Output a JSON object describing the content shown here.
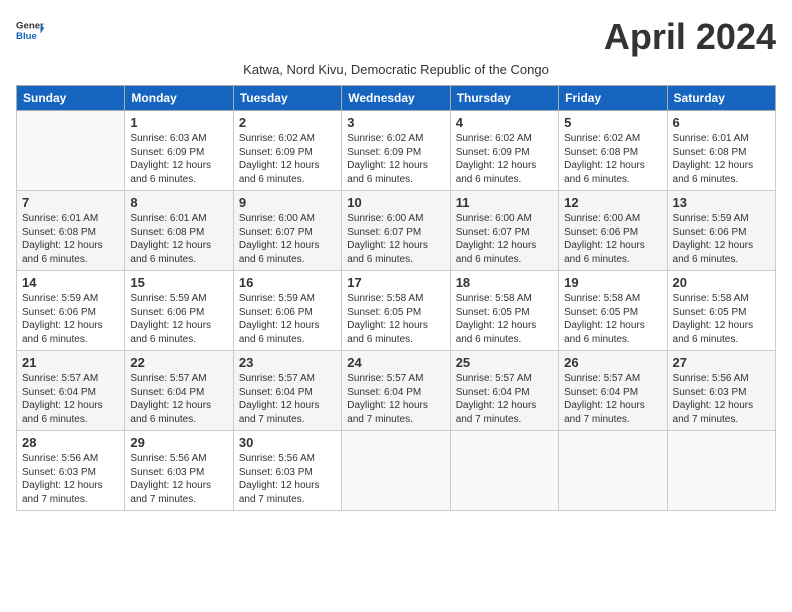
{
  "header": {
    "logo_general": "General",
    "logo_blue": "Blue",
    "month_title": "April 2024",
    "subtitle": "Katwa, Nord Kivu, Democratic Republic of the Congo"
  },
  "weekdays": [
    "Sunday",
    "Monday",
    "Tuesday",
    "Wednesday",
    "Thursday",
    "Friday",
    "Saturday"
  ],
  "weeks": [
    [
      {
        "day": "",
        "info": ""
      },
      {
        "day": "1",
        "info": "Sunrise: 6:03 AM\nSunset: 6:09 PM\nDaylight: 12 hours\nand 6 minutes."
      },
      {
        "day": "2",
        "info": "Sunrise: 6:02 AM\nSunset: 6:09 PM\nDaylight: 12 hours\nand 6 minutes."
      },
      {
        "day": "3",
        "info": "Sunrise: 6:02 AM\nSunset: 6:09 PM\nDaylight: 12 hours\nand 6 minutes."
      },
      {
        "day": "4",
        "info": "Sunrise: 6:02 AM\nSunset: 6:09 PM\nDaylight: 12 hours\nand 6 minutes."
      },
      {
        "day": "5",
        "info": "Sunrise: 6:02 AM\nSunset: 6:08 PM\nDaylight: 12 hours\nand 6 minutes."
      },
      {
        "day": "6",
        "info": "Sunrise: 6:01 AM\nSunset: 6:08 PM\nDaylight: 12 hours\nand 6 minutes."
      }
    ],
    [
      {
        "day": "7",
        "info": "Sunrise: 6:01 AM\nSunset: 6:08 PM\nDaylight: 12 hours\nand 6 minutes."
      },
      {
        "day": "8",
        "info": "Sunrise: 6:01 AM\nSunset: 6:08 PM\nDaylight: 12 hours\nand 6 minutes."
      },
      {
        "day": "9",
        "info": "Sunrise: 6:00 AM\nSunset: 6:07 PM\nDaylight: 12 hours\nand 6 minutes."
      },
      {
        "day": "10",
        "info": "Sunrise: 6:00 AM\nSunset: 6:07 PM\nDaylight: 12 hours\nand 6 minutes."
      },
      {
        "day": "11",
        "info": "Sunrise: 6:00 AM\nSunset: 6:07 PM\nDaylight: 12 hours\nand 6 minutes."
      },
      {
        "day": "12",
        "info": "Sunrise: 6:00 AM\nSunset: 6:06 PM\nDaylight: 12 hours\nand 6 minutes."
      },
      {
        "day": "13",
        "info": "Sunrise: 5:59 AM\nSunset: 6:06 PM\nDaylight: 12 hours\nand 6 minutes."
      }
    ],
    [
      {
        "day": "14",
        "info": "Sunrise: 5:59 AM\nSunset: 6:06 PM\nDaylight: 12 hours\nand 6 minutes."
      },
      {
        "day": "15",
        "info": "Sunrise: 5:59 AM\nSunset: 6:06 PM\nDaylight: 12 hours\nand 6 minutes."
      },
      {
        "day": "16",
        "info": "Sunrise: 5:59 AM\nSunset: 6:06 PM\nDaylight: 12 hours\nand 6 minutes."
      },
      {
        "day": "17",
        "info": "Sunrise: 5:58 AM\nSunset: 6:05 PM\nDaylight: 12 hours\nand 6 minutes."
      },
      {
        "day": "18",
        "info": "Sunrise: 5:58 AM\nSunset: 6:05 PM\nDaylight: 12 hours\nand 6 minutes."
      },
      {
        "day": "19",
        "info": "Sunrise: 5:58 AM\nSunset: 6:05 PM\nDaylight: 12 hours\nand 6 minutes."
      },
      {
        "day": "20",
        "info": "Sunrise: 5:58 AM\nSunset: 6:05 PM\nDaylight: 12 hours\nand 6 minutes."
      }
    ],
    [
      {
        "day": "21",
        "info": "Sunrise: 5:57 AM\nSunset: 6:04 PM\nDaylight: 12 hours\nand 6 minutes."
      },
      {
        "day": "22",
        "info": "Sunrise: 5:57 AM\nSunset: 6:04 PM\nDaylight: 12 hours\nand 6 minutes."
      },
      {
        "day": "23",
        "info": "Sunrise: 5:57 AM\nSunset: 6:04 PM\nDaylight: 12 hours\nand 7 minutes."
      },
      {
        "day": "24",
        "info": "Sunrise: 5:57 AM\nSunset: 6:04 PM\nDaylight: 12 hours\nand 7 minutes."
      },
      {
        "day": "25",
        "info": "Sunrise: 5:57 AM\nSunset: 6:04 PM\nDaylight: 12 hours\nand 7 minutes."
      },
      {
        "day": "26",
        "info": "Sunrise: 5:57 AM\nSunset: 6:04 PM\nDaylight: 12 hours\nand 7 minutes."
      },
      {
        "day": "27",
        "info": "Sunrise: 5:56 AM\nSunset: 6:03 PM\nDaylight: 12 hours\nand 7 minutes."
      }
    ],
    [
      {
        "day": "28",
        "info": "Sunrise: 5:56 AM\nSunset: 6:03 PM\nDaylight: 12 hours\nand 7 minutes."
      },
      {
        "day": "29",
        "info": "Sunrise: 5:56 AM\nSunset: 6:03 PM\nDaylight: 12 hours\nand 7 minutes."
      },
      {
        "day": "30",
        "info": "Sunrise: 5:56 AM\nSunset: 6:03 PM\nDaylight: 12 hours\nand 7 minutes."
      },
      {
        "day": "",
        "info": ""
      },
      {
        "day": "",
        "info": ""
      },
      {
        "day": "",
        "info": ""
      },
      {
        "day": "",
        "info": ""
      }
    ]
  ]
}
